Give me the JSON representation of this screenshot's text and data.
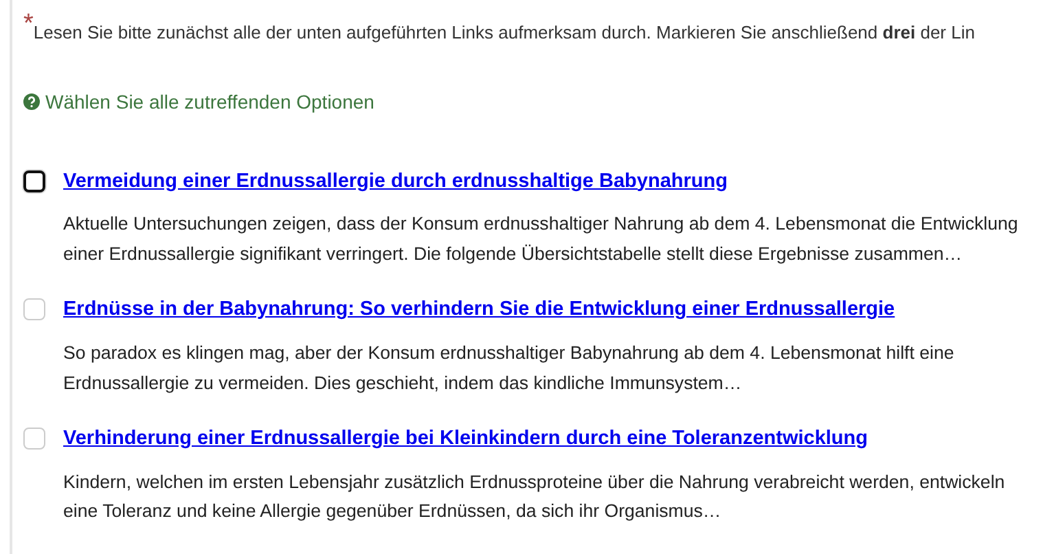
{
  "question": {
    "required_mark": "*",
    "text": "Lesen Sie bitte zunächst alle der unten aufgeführten Links aufmerksam durch. Markieren Sie anschließend **drei** der Lin"
  },
  "help": {
    "text": "Wählen Sie alle zutreffenden Optionen"
  },
  "options": [
    {
      "title": "Vermeidung einer Erdnussallergie durch erdnusshaltige Babynahrung",
      "description": "Aktuelle Untersuchungen zeigen, dass der Konsum erdnusshaltiger Nahrung ab dem 4. Lebensmonat die Entwicklung einer Erdnussallergie signifikant verringert. Die folgende Übersichtstabelle stellt diese Ergebnisse zusammen…",
      "checked": false,
      "focused": true
    },
    {
      "title": "Erdnüsse in der Babynahrung: So verhindern Sie die Entwicklung einer Erdnussallergie",
      "description": "So paradox es klingen mag, aber der Konsum erdnusshaltiger Babynahrung ab dem 4. Lebensmonat hilft eine Erdnussallergie zu vermeiden. Dies geschieht, indem das kindliche Immunsystem…",
      "checked": false,
      "focused": false
    },
    {
      "title": "Verhinderung einer Erdnussallergie bei Kleinkindern durch eine Toleranzentwicklung",
      "description": "Kindern, welchen im ersten Lebensjahr zusätzlich Erdnussproteine über die Nahrung verabreicht werden, entwickeln eine Toleranz und keine Allergie gegenüber Erdnüssen, da sich ihr Organismus…",
      "checked": false,
      "focused": false
    }
  ]
}
